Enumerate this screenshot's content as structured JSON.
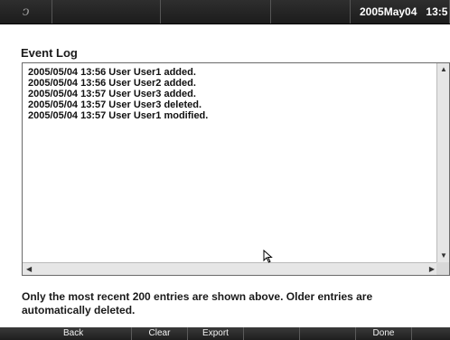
{
  "topbar": {
    "logo_glyph": "ↄ",
    "date": "2005May04",
    "time": "13:5"
  },
  "page": {
    "title": "Event Log"
  },
  "log": {
    "entries": [
      "2005/05/04 13:56 User User1 added.",
      "2005/05/04 13:56 User User2 added.",
      "2005/05/04 13:57 User User3 added.",
      "2005/05/04 13:57 User User3 deleted.",
      "2005/05/04 13:57 User User1 modified."
    ]
  },
  "note": "Only the most recent 200 entries are shown above. Older entries are automatically deleted.",
  "buttons": {
    "back": "Back",
    "clear": "Clear",
    "export": "Export",
    "done": "Done"
  },
  "icons": {
    "logo": "logo-icon",
    "cursor": "mouse-pointer-icon",
    "scroll_up": "scroll-up-arrow-icon",
    "scroll_down": "scroll-down-arrow-icon",
    "scroll_left": "scroll-left-arrow-icon",
    "scroll_right": "scroll-right-arrow-icon"
  },
  "colors": {
    "topbar_bg": "#1c1c1c",
    "page_bg": "#ffffff",
    "text": "#111111"
  }
}
